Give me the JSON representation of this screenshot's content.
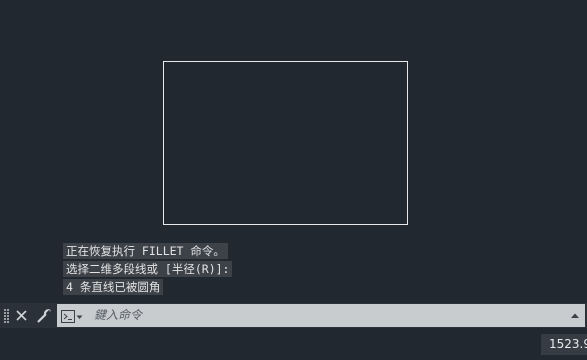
{
  "command_history": [
    "正在恢复执行 FILLET 命令。",
    "选择二维多段线或 [半径(R)]:",
    "4 条直线已被圆角"
  ],
  "command_line": {
    "placeholder": "鍵入命令"
  },
  "status_bar": {
    "coordinates": "1523.9"
  },
  "icons": {
    "close": "close-icon",
    "customize": "wrench-icon",
    "prompt": "command-prompt-icon",
    "dropdown": "chevron-down-icon",
    "history": "chevron-up-icon"
  },
  "colors": {
    "background": "#212830",
    "drawing_line": "#e6e8ea",
    "history_bg": "#3d4249",
    "input_bg": "#c9cccf"
  }
}
